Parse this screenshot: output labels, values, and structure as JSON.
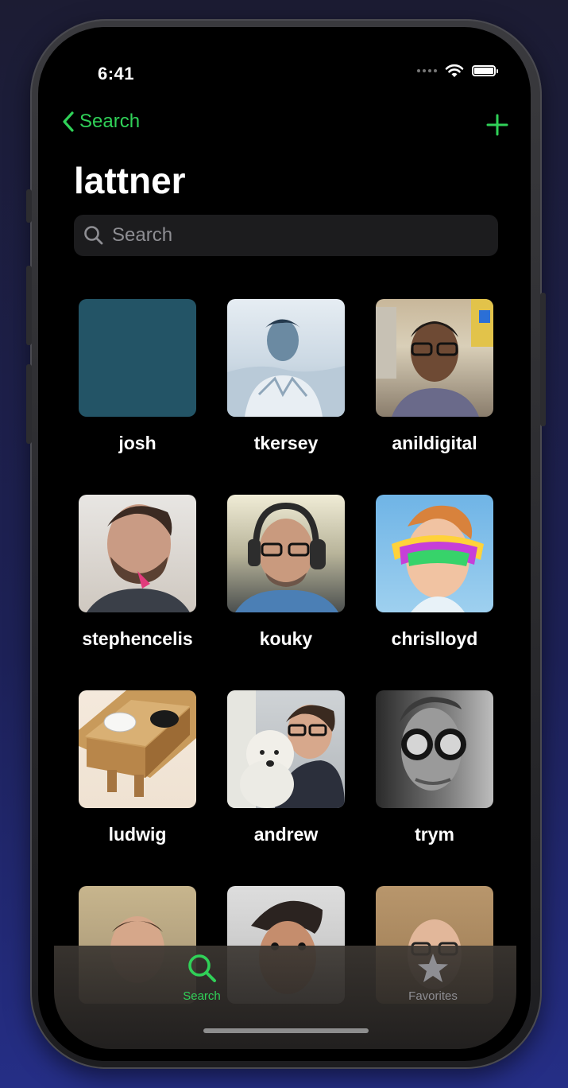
{
  "status": {
    "time": "6:41"
  },
  "nav": {
    "back_label": "Search"
  },
  "title": "lattner",
  "search": {
    "placeholder": "Search"
  },
  "colors": {
    "accent": "#30d158",
    "background": "#000000",
    "search_field": "#1c1c1e",
    "tab_inactive": "#8e8e93"
  },
  "users": [
    {
      "name": "josh"
    },
    {
      "name": "tkersey"
    },
    {
      "name": "anildigital"
    },
    {
      "name": "stephencelis"
    },
    {
      "name": "kouky"
    },
    {
      "name": "chrislloyd"
    },
    {
      "name": "ludwig"
    },
    {
      "name": "andrew"
    },
    {
      "name": "trym"
    },
    {
      "name": ""
    },
    {
      "name": ""
    },
    {
      "name": ""
    }
  ],
  "tabs": [
    {
      "label": "Search",
      "icon": "magnifier-icon",
      "active": true
    },
    {
      "label": "Favorites",
      "icon": "star-icon",
      "active": false
    }
  ]
}
